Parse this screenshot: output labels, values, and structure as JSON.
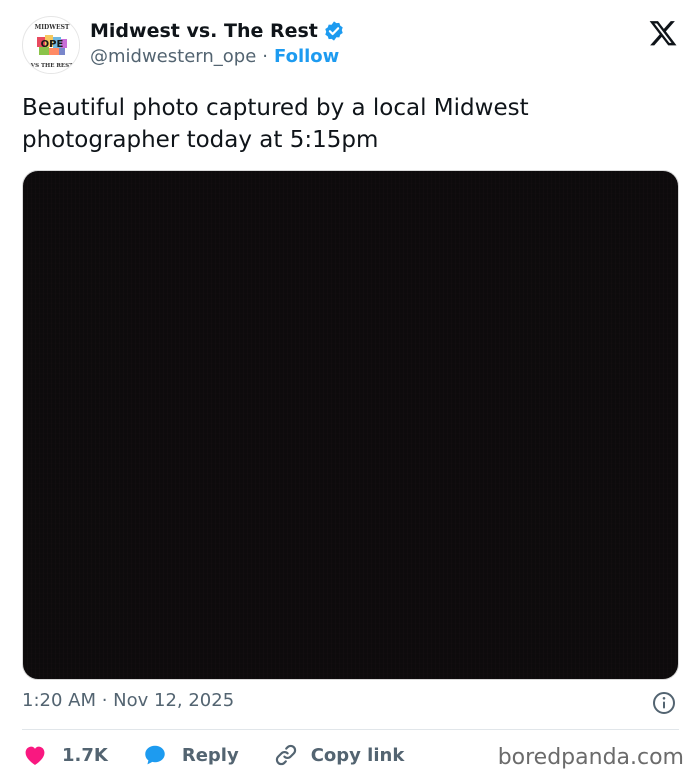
{
  "account": {
    "display_name": "Midwest vs. The Rest",
    "handle": "@midwestern_ope",
    "separator": "·",
    "follow_label": "Follow",
    "avatar_text_top": "MIDWEST",
    "avatar_text_center": "OPE",
    "avatar_text_bottom": "VS THE REST"
  },
  "tweet": {
    "text": "Beautiful photo captured by a local Midwest photographer today at 5:15pm",
    "timestamp": "1:20 AM · Nov 12, 2025"
  },
  "actions": {
    "likes_count": "1.7K",
    "reply_label": "Reply",
    "copy_link_label": "Copy link"
  },
  "watermark": "boredpanda.com",
  "colors": {
    "accent": "#1d9bf0",
    "heart": "#f91880",
    "text": "#0f1419",
    "muted": "#536471",
    "media_bg": "#0d0b0c"
  },
  "icons": [
    "verified-badge-icon",
    "x-logo-icon",
    "info-icon",
    "heart-icon",
    "reply-bubble-icon",
    "link-icon"
  ]
}
